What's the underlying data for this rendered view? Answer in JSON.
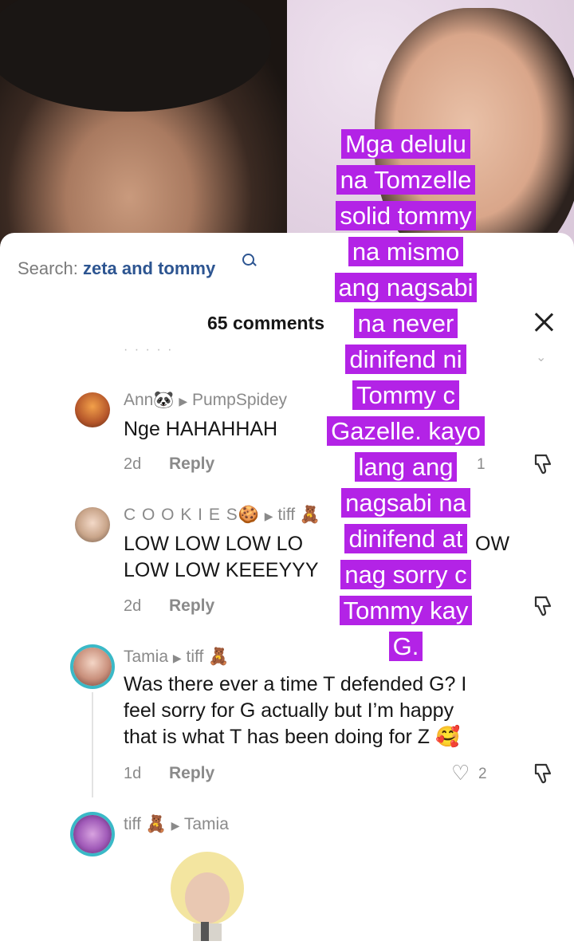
{
  "search": {
    "label": "Search:",
    "query": "zeta and tommy"
  },
  "comments_count": "65 comments",
  "faint_row": "·  ·  ·  ·  ·",
  "comments": [
    {
      "user": "Ann🐼",
      "reply_to": "PumpSpidey",
      "text": "Nge HAHAHHAH",
      "age": "2d",
      "reply": "Reply",
      "likes": "1"
    },
    {
      "user": "C O O K I E S🍪",
      "reply_to": "tiff 🧸",
      "text_l1": "LOW LOW LOW LO",
      "text_l1_end": "OW",
      "text_l2": "LOW LOW KEEEYYY",
      "age": "2d",
      "reply": "Reply"
    },
    {
      "user": "Tamia",
      "reply_to": "tiff 🧸",
      "text_l1": "Was there ever a time T defended G? I",
      "text_l2": "feel sorry for G actually but I’m happy",
      "text_l3": "that is what T has been doing for Z 🥰",
      "age": "1d",
      "reply": "Reply",
      "likes": "2"
    },
    {
      "user": "tiff 🧸",
      "reply_to": "Tamia"
    }
  ],
  "overlay_lines": [
    "Mga delulu",
    "na Tomzelle",
    "solid tommy",
    "na mismo",
    "ang nagsabi",
    "na never",
    "dinifend ni",
    "Tommy c",
    "Gazelle. kayo",
    "lang ang",
    "nagsabi na",
    "dinifend at",
    "nag sorry c",
    "Tommy kay",
    "G."
  ],
  "colors": {
    "overlay_bg": "#b323e6",
    "link": "#2d5591",
    "avatar_ring": "#3ab9c7"
  }
}
